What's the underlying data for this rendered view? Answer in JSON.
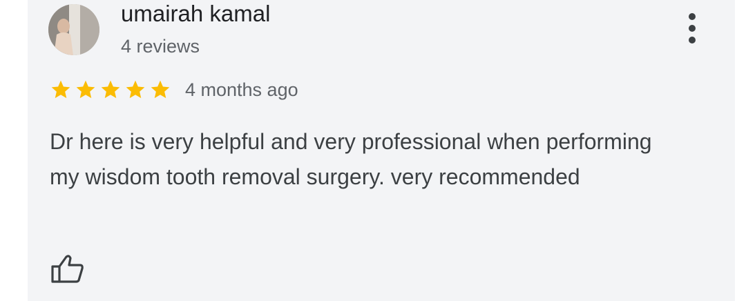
{
  "review": {
    "reviewer_name": "umairah kamal",
    "review_count": "4 reviews",
    "rating": 5,
    "rating_max": 5,
    "date": "4 months ago",
    "text": "Dr here is very helpful and very professional when performing my wisdom tooth removal surgery. very recommended"
  },
  "icons": {
    "more": "more-vert-icon",
    "star": "star-icon",
    "like": "thumbs-up-icon",
    "avatar": "avatar-photo"
  },
  "colors": {
    "card_background": "#f3f4f6",
    "star": "#fbbc04",
    "name_text": "#202124",
    "secondary_text": "#5f6368",
    "body_text": "#3c4043"
  }
}
